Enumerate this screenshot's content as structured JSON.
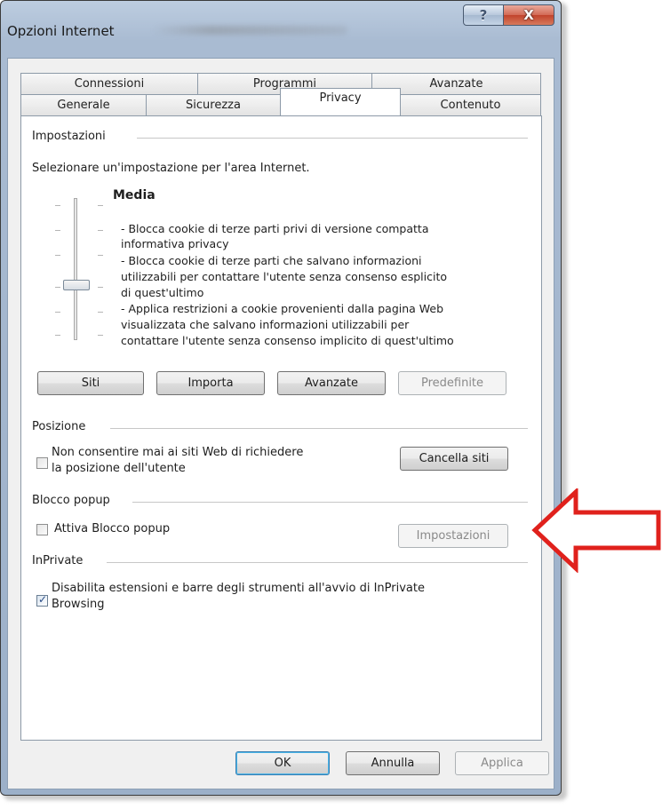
{
  "window": {
    "title": "Opzioni Internet",
    "help_glyph": "?",
    "close_glyph": "X"
  },
  "tabs": {
    "row1": [
      "Connessioni",
      "Programmi",
      "Avanzate"
    ],
    "row2": [
      "Generale",
      "Sicurezza",
      "Privacy",
      "Contenuto"
    ],
    "active": "Privacy"
  },
  "settings": {
    "group_label": "Impostazioni",
    "instruction": "Selezionare un'impostazione per l'area Internet.",
    "level": "Media",
    "description_lines": [
      "- Blocca cookie di terze parti privi di versione compatta",
      "informativa privacy",
      "- Blocca cookie di terze parti che salvano informazioni",
      "utilizzabili per contattare l'utente senza consenso esplicito",
      "di quest'ultimo",
      "- Applica restrizioni a cookie provenienti dalla pagina Web",
      "visualizzata che salvano informazioni utilizzabili per",
      "contattare l'utente senza consenso implicito di quest'ultimo"
    ],
    "buttons": {
      "siti": "Siti",
      "importa": "Importa",
      "avanzate": "Avanzate",
      "predefinite": "Predefinite"
    }
  },
  "location": {
    "group_label": "Posizione",
    "checkbox_line1": "Non consentire mai ai siti Web di richiedere",
    "checkbox_line2": "la posizione dell'utente",
    "checked": false,
    "clear_button": "Cancella siti"
  },
  "popup": {
    "group_label": "Blocco popup",
    "checkbox_label": "Attiva Blocco popup",
    "checked": false,
    "settings_button": "Impostazioni"
  },
  "inprivate": {
    "group_label": "InPrivate",
    "checkbox_line1": "Disabilita estensioni e barre degli strumenti all'avvio di InPrivate",
    "checkbox_line2": "Browsing",
    "checked": true
  },
  "footer": {
    "ok": "OK",
    "annulla": "Annulla",
    "applica": "Applica"
  },
  "annotation": {
    "arrow_color": "#e0211c"
  }
}
